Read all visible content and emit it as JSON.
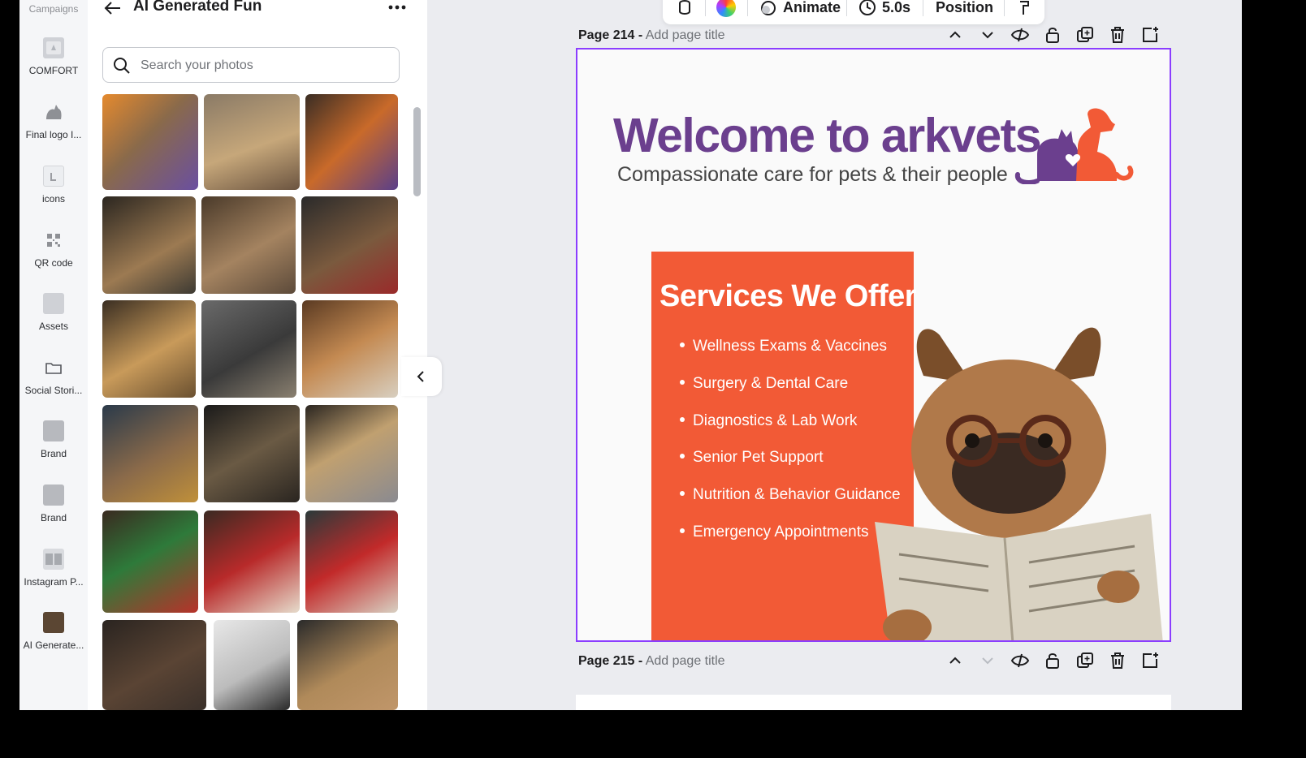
{
  "rail": {
    "top_label": "Campaigns",
    "items": [
      {
        "label": "COMFORT",
        "icon": "folder-thumbnail"
      },
      {
        "label": "Final logo I...",
        "icon": "logo-thumbnail"
      },
      {
        "label": "icons",
        "icon": "icons-thumbnail"
      },
      {
        "label": "QR code",
        "icon": "qr-code-icon"
      },
      {
        "label": "Assets",
        "icon": "assets-thumbnail"
      },
      {
        "label": "Social Stori...",
        "icon": "folder-icon"
      },
      {
        "label": "Brand",
        "icon": "brand-thumbnail"
      },
      {
        "label": "Brand",
        "icon": "brand-thumbnail"
      },
      {
        "label": "Instagram P...",
        "icon": "instagram-thumbnail"
      },
      {
        "label": "AI Generate...",
        "icon": "ai-generated-thumbnail"
      }
    ]
  },
  "panel": {
    "title": "AI Generated Fun",
    "search_placeholder": "Search your photos",
    "photos": [
      "dog and cat in orange and purple bandanas",
      "cat with glasses reading a book",
      "dog and cat in orange and purple bandanas",
      "cat pointing with dog",
      "cat with magnifying glass",
      "dog wizard with wand",
      "dog in tan robe",
      "cat with goggles in leather jacket",
      "french bulldog reading newspaper",
      "cat in top hat and suit",
      "dogs with sparkles",
      "dog with goggles in sequin jacket",
      "cat in elf costume with gift",
      "bulldog in santa costume",
      "bulldog in santa hat on armchair",
      "dog detective with magnifying glass",
      "woman walking in hallway",
      "dog with stacked boxes"
    ]
  },
  "toolbar": {
    "animate_label": "Animate",
    "duration_label": "5.0s",
    "position_label": "Position"
  },
  "pages": [
    {
      "number_label": "Page 214 -",
      "title_placeholder": "Add page title"
    },
    {
      "number_label": "Page 215 -",
      "title_placeholder": "Add page title"
    }
  ],
  "design": {
    "headline": "Welcome to arkvets",
    "tagline": "Compassionate care for pets & their people",
    "services_title": "Services We Offer",
    "services": [
      "Wellness Exams & Vaccines",
      "Surgery & Dental Care",
      "Diagnostics & Lab Work",
      "Senior Pet Support",
      "Nutrition & Behavior Guidance",
      "Emergency Appointments"
    ],
    "colors": {
      "purple": "#6b3f8e",
      "orange": "#f25a36",
      "selection": "#8b3dff"
    }
  }
}
